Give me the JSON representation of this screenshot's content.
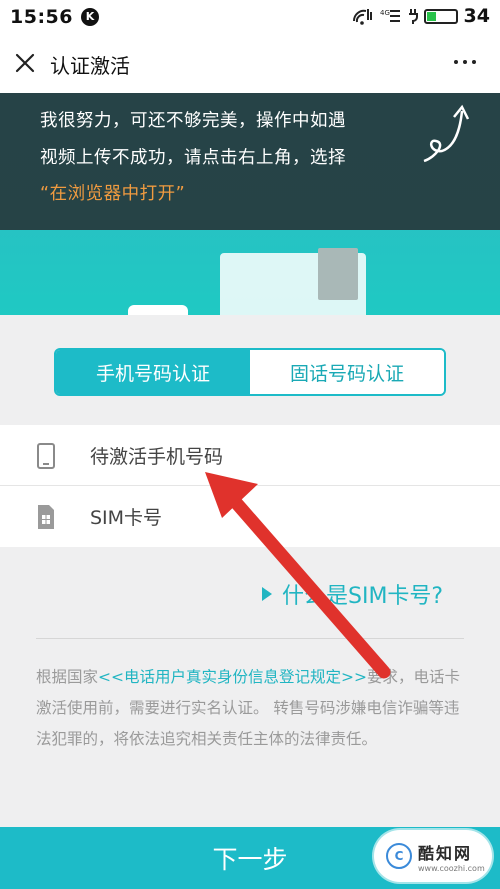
{
  "status_bar": {
    "time": "15:56",
    "k_badge": "K",
    "battery": "34",
    "battery_level": 0.34
  },
  "navbar": {
    "title": "认证激活"
  },
  "banner": {
    "line1": "我很努力，可还不够完美，操作中如遇",
    "line2": "视频上传不成功，请点击右上角，选择",
    "line3": "“在浏览器中打开”"
  },
  "tabs": {
    "mobile": "手机号码认证",
    "landline": "固话号码认证"
  },
  "form": {
    "phone_label": "待激活手机号码",
    "sim_label": "SIM卡号"
  },
  "sim_link": "什么是SIM卡号?",
  "notice": {
    "prefix": "根据国家",
    "regulation": "<<电话用户真实身份信息登记规定>>",
    "suffix": "要求，电话卡激活使用前，需要进行实名认证。 转售号码涉嫌电信诈骗等违法犯罪的，将依法追究相关责任主体的法律责任。"
  },
  "next_button": "下一步",
  "watermark": {
    "logo": "C",
    "name": "酷知网",
    "url": "www.coozhi.com"
  },
  "colors": {
    "accent": "#1dbbc8",
    "arrow": "#e0322c",
    "highlight": "#f09b40"
  }
}
